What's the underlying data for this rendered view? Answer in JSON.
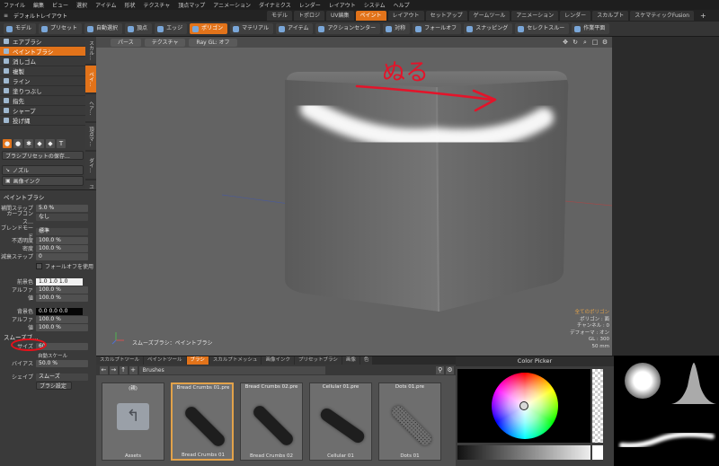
{
  "menu": [
    "ファイル",
    "編集",
    "ビュー",
    "選択",
    "アイテム",
    "形状",
    "テクスチャ",
    "頂点マップ",
    "アニメーション",
    "ダイナミクス",
    "レンダー",
    "レイアウト",
    "システム",
    "ヘルプ"
  ],
  "layout": {
    "title": "デフォルトレイアウト",
    "tabs": [
      "モデル",
      "トポロジ",
      "UV編集",
      "ペイント",
      "レイアウト",
      "セットアップ",
      "ゲームツール",
      "アニメーション",
      "レンダー",
      "スカルプト",
      "スケマティックFusion"
    ],
    "active_tab": "ペイント",
    "add_label": "+"
  },
  "toolbar": {
    "items": [
      "モデル",
      "プリセット",
      "自動選択",
      "頂点",
      "エッジ",
      "ポリゴン",
      "マテリアル",
      "アイテム",
      "アクションセンター",
      "対称",
      "フォールオフ",
      "スナッピング",
      "セレクトスルー",
      "作業平面"
    ],
    "active": "ポリゴン"
  },
  "tools": {
    "items": [
      "エアブラシ",
      "ペイントブラシ",
      "消しゴム",
      "複製",
      "ライン",
      "塗りつぶし",
      "指先",
      "シャープ",
      "投げ縄"
    ],
    "selected": "ペイントブラシ",
    "vtabs": [
      "スカル…",
      "ペイ…",
      "ヘア…",
      "頂点マ…",
      "ダイ…",
      "ユーザ…"
    ],
    "active_vtab": "ペイ…",
    "icon_glyphs": [
      "●",
      "●",
      "✱",
      "◆",
      "◆",
      "T"
    ],
    "brush_preset_btn": "ブラシプリセットの保存…",
    "nozzle_btn": "ノズル",
    "image_ink_btn": "画像インク"
  },
  "props": {
    "section": "ペイントブラシ",
    "stamp_label": "補間ステップ",
    "stamp_value": "5.0 %",
    "curve_label": "カーブコンス…",
    "curve_value": "なし",
    "blend_label": "ブレンドモード",
    "blend_value": "標準",
    "opacity_label": "不透明度",
    "opacity_value": "100.0 %",
    "density_label": "密度",
    "density_value": "100.0 %",
    "step_label": "減衰ステップ",
    "step_value": "0",
    "falloff_checkbox": "フォールオフを使用",
    "fg_label": "前景色",
    "fg_value": "1.0   1.0   1.0",
    "fg_alpha_label": "アルファ",
    "fg_alpha_value": "100.0 %",
    "fg_val_label": "値",
    "fg_val_value": "100.0 %",
    "bg_label": "背景色",
    "bg_value": "0.0   0.0   0.0",
    "bg_alpha_label": "アルファ",
    "bg_alpha_value": "100.0 %",
    "bg_val_label": "値",
    "bg_val_value": "100.0 %",
    "smooth_section": "スムーズブ…",
    "size_label": "サイズ",
    "size_value": "60",
    "auto_scale": "自動スケール",
    "bias_label": "バイアス",
    "bias_value": "50.0 %",
    "shape_label": "シェイプ",
    "shape_value": "スムーズ",
    "brush_settings_btn": "ブラシ設定"
  },
  "viewport": {
    "buttons": [
      "パース",
      "テクスチャ",
      "Ray GL: オフ"
    ],
    "handwriting": "ぬる",
    "status": "スムーズブラシ：ペイントブラシ",
    "icons": [
      "move-icon",
      "rotate-icon",
      "zoom-icon",
      "maximize-icon",
      "settings-icon"
    ],
    "info": {
      "title": "全てのポリゴン",
      "lines": [
        "ポリゴン : 面",
        "チャンネル : 0",
        "デフォーマ : オン",
        "GL : 300",
        "50 mm"
      ]
    },
    "accent_color": "#e2731a"
  },
  "bottom": {
    "tabs": [
      "スカルプトツール",
      "ペイントツール",
      "ブラシ",
      "スカルプトメッシュ",
      "画像インク",
      "プリセットブラシ",
      "画像",
      "色"
    ],
    "active_tab": "ブラシ",
    "path_value": "Brushes",
    "thumbs": [
      {
        "name": "(親)",
        "footer": "Assets",
        "kind": "folder"
      },
      {
        "name": "Bread Crumbs 01.pre",
        "footer": "Bread Crumbs 01",
        "kind": "brush"
      },
      {
        "name": "Bread Crumbs 02.pre",
        "footer": "Bread Crumbs 02",
        "kind": "brush"
      },
      {
        "name": "Cellular 01.pre",
        "footer": "Cellular 01",
        "kind": "brush"
      },
      {
        "name": "Dots 01.pre",
        "footer": "Dots 01",
        "kind": "brush"
      }
    ],
    "selected_thumb": "Bread Crumbs 01.pre"
  },
  "color_picker": {
    "title": "Color Picker"
  }
}
